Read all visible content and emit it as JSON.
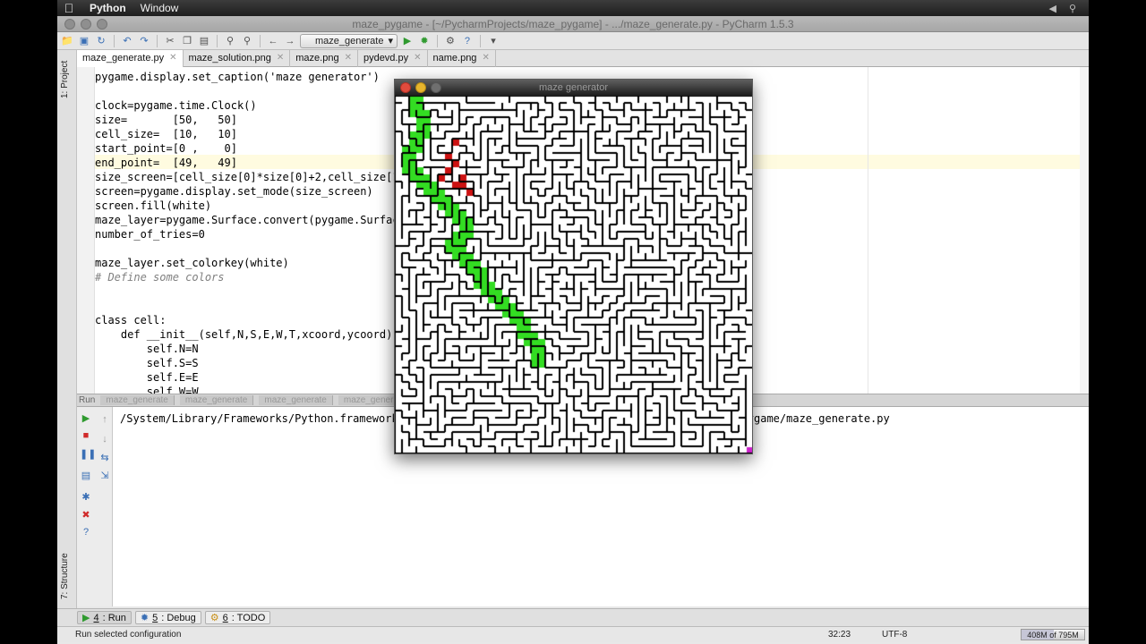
{
  "menubar": {
    "app": "Python",
    "window": "Window"
  },
  "window": {
    "title": "maze_pygame - [~/PycharmProjects/maze_pygame] - .../maze_generate.py - PyCharm 1.5.3"
  },
  "toolbar": {
    "run_config": "maze_generate"
  },
  "tabs": [
    {
      "label": "maze_generate.py",
      "active": true
    },
    {
      "label": "maze_solution.png",
      "active": false
    },
    {
      "label": "maze.png",
      "active": false
    },
    {
      "label": "pydevd.py",
      "active": false
    },
    {
      "label": "name.png",
      "active": false
    }
  ],
  "side_panels": {
    "project": "1: Project",
    "structure": "7: Structure"
  },
  "code": [
    "pygame.display.set_caption('maze generator')",
    "",
    "clock=pygame.time.Clock()",
    "size=       [50,   50]",
    "cell_size=  [10,   10]",
    "start_point=[0 ,    0]",
    "end_point=  [49,   49]",
    "size_screen=[cell_size[0]*size[0]+2,cell_size[1]*size[1]+2]",
    "screen=pygame.display.set_mode(size_screen)",
    "screen.fill(white)",
    "maze_layer=pygame.Surface.convert(pygame.Surface(size_screen))",
    "number_of_tries=0",
    "",
    "maze_layer.set_colorkey(white)",
    "# Define some colors",
    "",
    "",
    "class cell:",
    "    def __init__(self,N,S,E,W,T,xcoord,ycoord):",
    "        self.N=N",
    "        self.S=S",
    "        self.E=E",
    "        self.W=W"
  ],
  "run_panel": {
    "label": "Run",
    "tabs": [
      "maze_generate",
      "maze_generate",
      "maze_generate",
      "maze_generate"
    ],
    "console_line": "/System/Library/Frameworks/Python.framework/Versions/2.7/bin/python /Users/PycharmProjects/maze_pygame/maze_generate.py"
  },
  "bottom_tabs": [
    {
      "num": "4",
      "label": ": Run",
      "active": true
    },
    {
      "num": "5",
      "label": ": Debug",
      "active": false
    },
    {
      "num": "6",
      "label": ": TODO",
      "active": false
    }
  ],
  "status": {
    "message": "Run selected configuration",
    "position": "32:23",
    "encoding": "UTF-8",
    "memory": "408M of 795M",
    "memory_used_fraction": 0.51
  },
  "maze_window": {
    "title": "maze generator",
    "grid_cells": 50,
    "colors": {
      "wall": "#000000",
      "path": "#33dd22",
      "dead_end": "#cc1111",
      "end": "#cc22cc"
    }
  },
  "colors": {
    "menubar": "#2a2a2a",
    "editor_bg": "#ffffff",
    "highlight_line": "#fffbe0"
  }
}
